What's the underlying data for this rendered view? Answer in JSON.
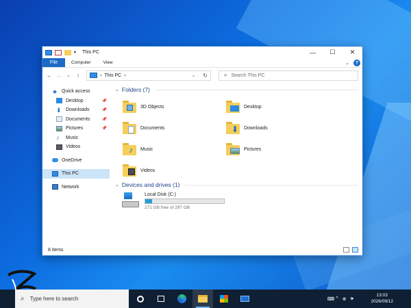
{
  "window": {
    "title": "This PC",
    "controls": {
      "minimize": "—",
      "maximize": "☐",
      "close": "✕"
    }
  },
  "ribbon": {
    "file": "File",
    "computer": "Computer",
    "view": "View",
    "help": "?"
  },
  "navbar": {
    "back": "←",
    "forward": "→",
    "recent": "⌄",
    "up": "↑",
    "breadcrumb": "This PC",
    "sep1": "›",
    "sep2": "›",
    "search_placeholder": "Search This PC"
  },
  "sidebar": {
    "quick_access": "Quick access",
    "items": [
      {
        "label": "Desktop",
        "icon": "desktop-icon",
        "pinned": true
      },
      {
        "label": "Downloads",
        "icon": "downloads-icon",
        "pinned": true
      },
      {
        "label": "Documents",
        "icon": "documents-icon",
        "pinned": true
      },
      {
        "label": "Pictures",
        "icon": "pictures-icon",
        "pinned": true
      },
      {
        "label": "Music",
        "icon": "music-icon",
        "pinned": false
      },
      {
        "label": "Videos",
        "icon": "videos-icon",
        "pinned": false
      }
    ],
    "onedrive": "OneDrive",
    "this_pc": "This PC",
    "network": "Network"
  },
  "content": {
    "folders_header": "Folders (7)",
    "folders": [
      {
        "label": "3D Objects",
        "icon": "3d-objects-icon"
      },
      {
        "label": "Desktop",
        "icon": "desktop-folder-icon"
      },
      {
        "label": "Documents",
        "icon": "documents-folder-icon"
      },
      {
        "label": "Downloads",
        "icon": "downloads-folder-icon"
      },
      {
        "label": "Music",
        "icon": "music-folder-icon"
      },
      {
        "label": "Pictures",
        "icon": "pictures-folder-icon"
      },
      {
        "label": "Videos",
        "icon": "videos-folder-icon"
      }
    ],
    "drives_header": "Devices and drives (1)",
    "drive": {
      "name": "Local Disk (C:)",
      "free_text": "271 GB free of 297 GB",
      "used_fraction": 0.088
    }
  },
  "status": {
    "items": "8 items"
  },
  "taskbar": {
    "search_placeholder": "Type here to search",
    "time": "13:03",
    "date": "2026/09/12",
    "tray_keyboard": "⌨",
    "tray_chevron": "^",
    "tray_globe": "⊕",
    "tray_sound": "🕪"
  },
  "colors": {
    "accent": "#1a6bc6",
    "selection": "#cce4f7",
    "taskbar": "#0f1f34",
    "group_header": "#1e3f8a"
  }
}
